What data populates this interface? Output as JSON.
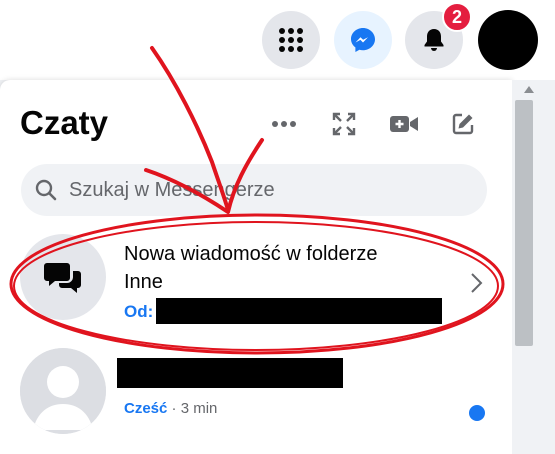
{
  "topbar": {
    "apps_icon": "grid-icon",
    "messenger_icon": "messenger-icon",
    "bell_icon": "bell-icon",
    "notification_count": "2"
  },
  "panel": {
    "title": "Czaty",
    "search_placeholder": "Szukaj w Messengerze",
    "header_icons": [
      "more-icon",
      "expand-icon",
      "video-call-icon",
      "compose-icon"
    ]
  },
  "chats": [
    {
      "title_line1": "Nowa wiadomość w folderze",
      "title_line2": "Inne",
      "from_label": "Od:"
    },
    {
      "last_message": "Cześć",
      "separator": " · ",
      "time": "3 min"
    }
  ],
  "colors": {
    "accent": "#1877f2",
    "badge": "#e41e3f",
    "annotation": "#e0141e"
  }
}
